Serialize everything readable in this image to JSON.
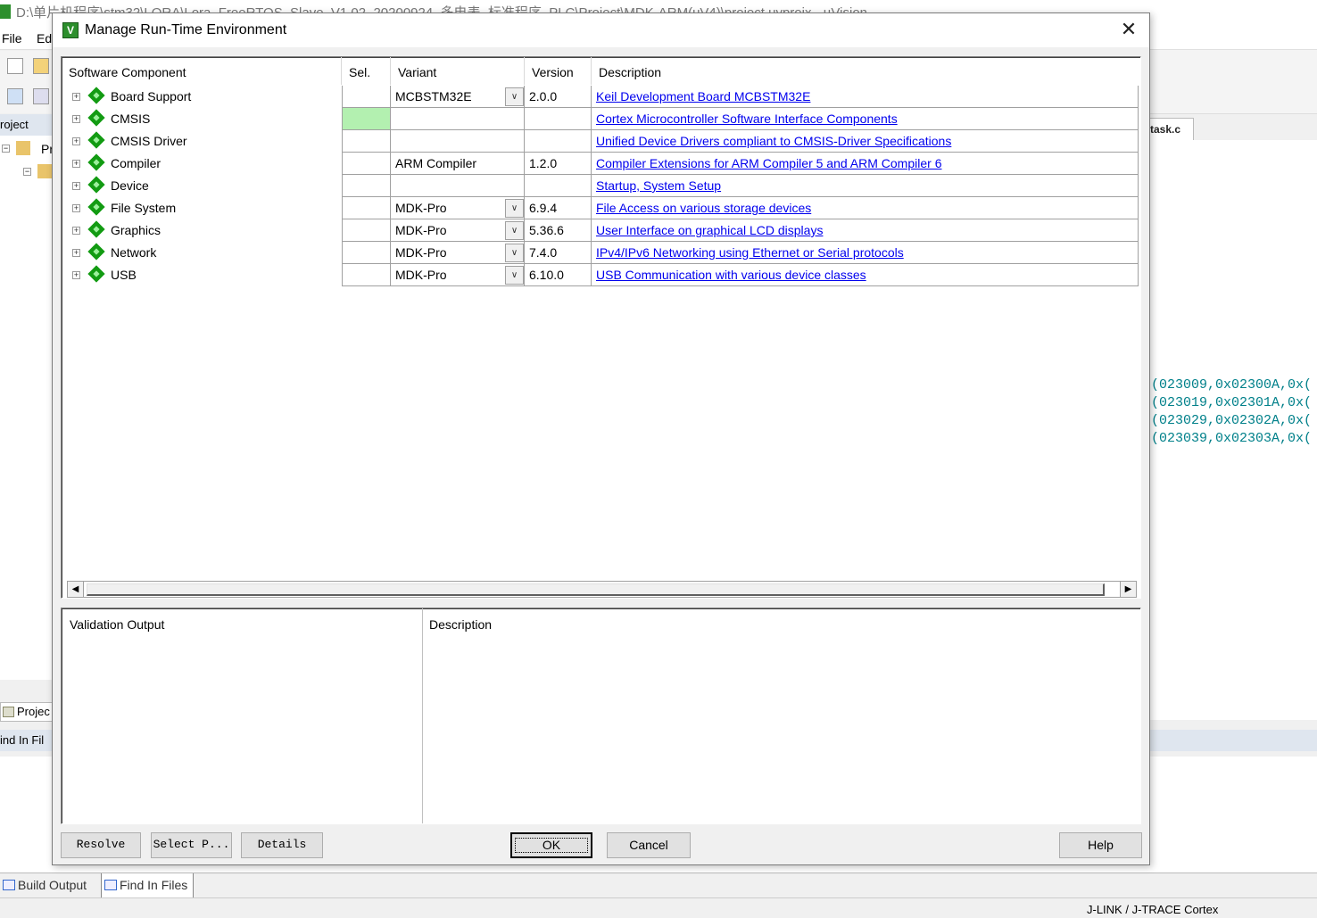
{
  "background": {
    "window_title": "D:\\单片机程序\\stm32\\LORA\\Lora_FreeRTOS_Slave_V1.02_20200924_多电表_标准程序_PLC\\Project\\MDK-ARM(uV4)\\project.uvprojx - µVision",
    "menu": [
      "File",
      "Ed"
    ],
    "project_header": "roject",
    "project_root": "Pr",
    "editor_tab": "task.c",
    "code_lines": [
      "(023009,0x02300A,0x(",
      "(023019,0x02301A,0x(",
      "(023029,0x02302A,0x(",
      "(023039,0x02303A,0x("
    ],
    "project_tab": "Projec",
    "find_header": "ind In Fil",
    "bottom_tabs": [
      "Build Output",
      "Find In Files"
    ],
    "status": "J-LINK / J-TRACE Cortex"
  },
  "dialog": {
    "title": "Manage Run-Time Environment",
    "close_glyph": "✕",
    "columns": {
      "component": "Software Component",
      "sel": "Sel.",
      "variant": "Variant",
      "version": "Version",
      "description": "Description"
    },
    "rows": [
      {
        "name": "Board Support",
        "variant": "MCBSTM32E",
        "has_dropdown": true,
        "version": "2.0.0",
        "description": "Keil Development Board MCBSTM32E",
        "sel_green": false
      },
      {
        "name": "CMSIS",
        "variant": "",
        "has_dropdown": false,
        "version": "",
        "description": "Cortex Microcontroller Software Interface Components",
        "sel_green": true
      },
      {
        "name": "CMSIS Driver",
        "variant": "",
        "has_dropdown": false,
        "version": "",
        "description": "Unified Device Drivers compliant to CMSIS-Driver Specifications",
        "sel_green": false
      },
      {
        "name": "Compiler",
        "variant": "ARM Compiler",
        "has_dropdown": false,
        "version": "1.2.0",
        "description": "Compiler Extensions for ARM Compiler 5 and ARM Compiler 6",
        "sel_green": false
      },
      {
        "name": "Device",
        "variant": "",
        "has_dropdown": false,
        "version": "",
        "description": "Startup, System Setup",
        "sel_green": false
      },
      {
        "name": "File System",
        "variant": "MDK-Pro",
        "has_dropdown": true,
        "version": "6.9.4",
        "description": "File Access on various storage devices",
        "sel_green": false
      },
      {
        "name": "Graphics",
        "variant": "MDK-Pro",
        "has_dropdown": true,
        "version": "5.36.6",
        "description": "User Interface on graphical LCD displays",
        "sel_green": false
      },
      {
        "name": "Network",
        "variant": "MDK-Pro",
        "has_dropdown": true,
        "version": "7.4.0",
        "description": "IPv4/IPv6 Networking using Ethernet or Serial protocols",
        "sel_green": false
      },
      {
        "name": "USB",
        "variant": "MDK-Pro",
        "has_dropdown": true,
        "version": "6.10.0",
        "description": "USB Communication with various device classes",
        "sel_green": false
      }
    ],
    "validation": {
      "output_label": "Validation Output",
      "description_label": "Description"
    },
    "buttons": {
      "resolve": "Resolve",
      "select_packs": "Select P...",
      "details": "Details",
      "ok": "OK",
      "cancel": "Cancel",
      "help": "Help"
    },
    "colors": {
      "link": "#0000ee",
      "sel_green": "#b3f0b0",
      "component_icon": "#129b12"
    }
  }
}
